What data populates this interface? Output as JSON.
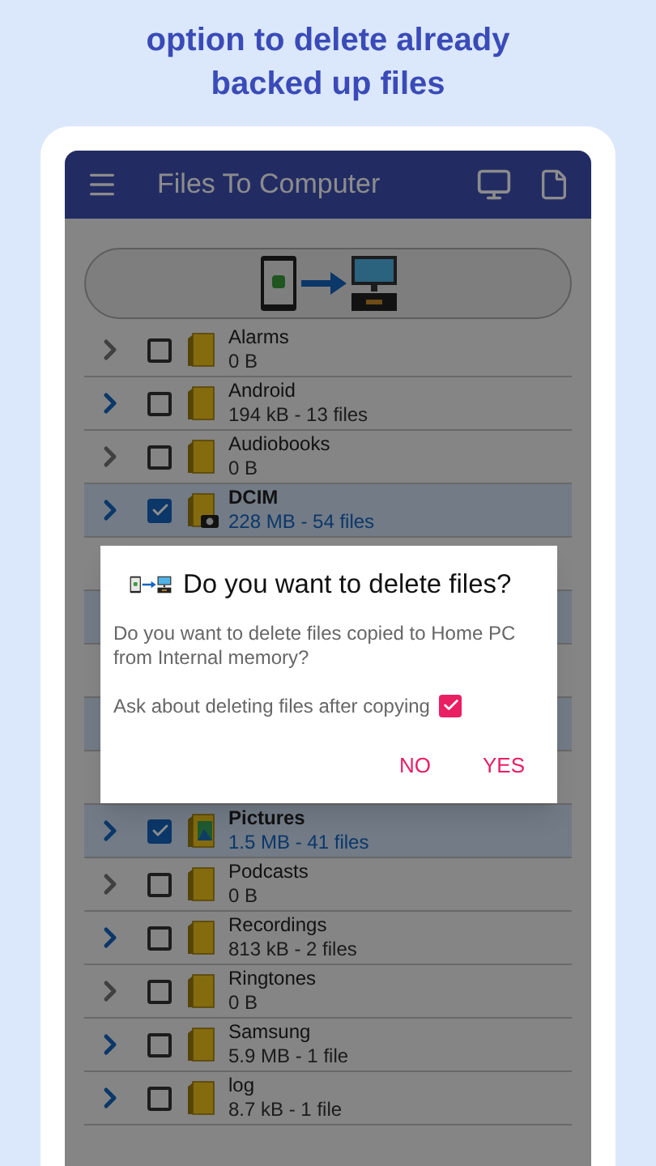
{
  "headline": "option to delete already backed up files",
  "app_bar": {
    "title": "Files To Computer"
  },
  "folders_top": [
    {
      "name": "Alarms",
      "info": "0 B",
      "checked": false,
      "expandable": false,
      "kind": "folder"
    },
    {
      "name": "Android",
      "info": "194 kB - 13 files",
      "checked": false,
      "expandable": true,
      "kind": "folder"
    },
    {
      "name": "Audiobooks",
      "info": "0 B",
      "checked": false,
      "expandable": false,
      "kind": "folder"
    },
    {
      "name": "DCIM",
      "info": "228 MB - 54 files",
      "checked": true,
      "expandable": true,
      "kind": "camera"
    }
  ],
  "folders_bottom": [
    {
      "name": "Pictures",
      "info": "1.5 MB - 41 files",
      "checked": true,
      "expandable": true,
      "kind": "pictures"
    },
    {
      "name": "Podcasts",
      "info": "0 B",
      "checked": false,
      "expandable": false,
      "kind": "folder"
    },
    {
      "name": "Recordings",
      "info": "813 kB - 2 files",
      "checked": false,
      "expandable": true,
      "kind": "folder"
    },
    {
      "name": "Ringtones",
      "info": "0 B",
      "checked": false,
      "expandable": false,
      "kind": "folder"
    },
    {
      "name": "Samsung",
      "info": "5.9 MB - 1 file",
      "checked": false,
      "expandable": true,
      "kind": "folder"
    },
    {
      "name": "log",
      "info": "8.7 kB - 1 file",
      "checked": false,
      "expandable": true,
      "kind": "folder"
    }
  ],
  "dialog": {
    "title": "Do you want to delete files?",
    "message": "Do you want to delete files copied to Home PC from Internal memory?",
    "option": {
      "label": "Ask about deleting files after copying",
      "checked": true
    },
    "buttons": [
      "NO",
      "YES"
    ]
  }
}
